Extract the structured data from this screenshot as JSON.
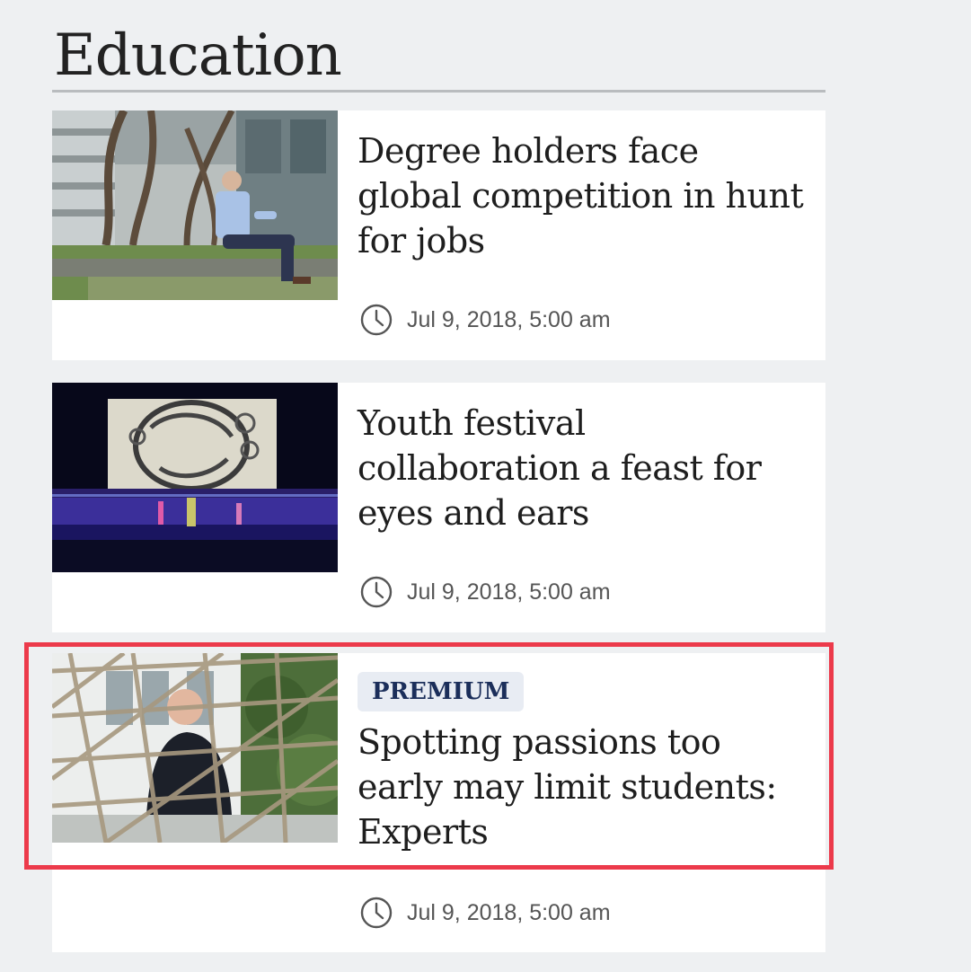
{
  "section": {
    "title": "Education"
  },
  "articles": [
    {
      "headline": "Degree holders face global competition in hunt for jobs",
      "timestamp": "Jul 9, 2018, 5:00 am",
      "icon": "clock-icon"
    },
    {
      "headline": "Youth festival collaboration a feast for eyes and ears",
      "timestamp": "Jul 9, 2018, 5:00 am",
      "icon": "clock-icon"
    },
    {
      "badge": "PREMIUM",
      "headline": "Spotting passions too early may limit students: Experts",
      "timestamp": "Jul 9, 2018, 5:00 am",
      "icon": "clock-icon"
    }
  ],
  "colors": {
    "page_background": "#eef0f2",
    "card_background": "#ffffff",
    "premium_badge_background": "#e8ecf3",
    "premium_badge_text": "#1b2e5a",
    "highlight_border": "#ec3a4b"
  }
}
